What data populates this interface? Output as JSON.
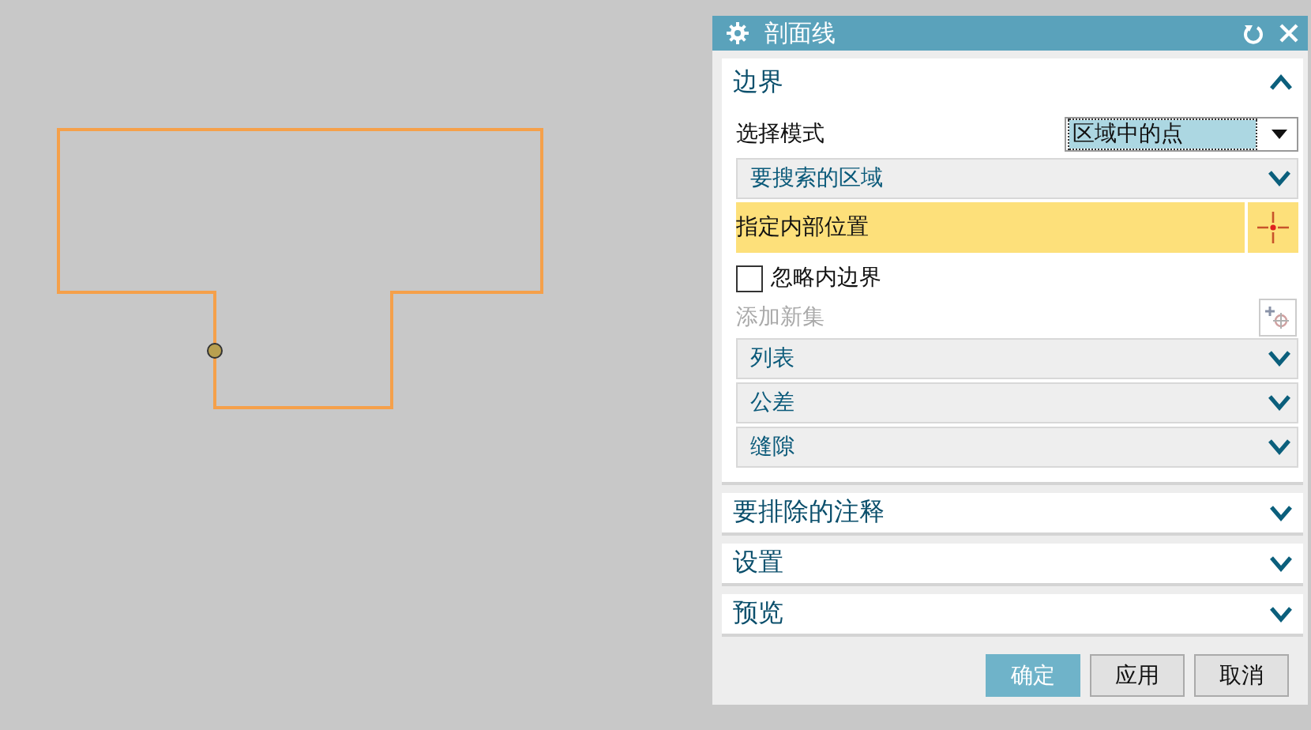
{
  "window": {
    "title": "剖面线"
  },
  "sections": [
    {
      "title": "边界",
      "expanded": true,
      "rows": [
        {
          "kind": "select",
          "label": "选择模式",
          "value": "区域中的点"
        },
        {
          "kind": "group",
          "title": "要搜索的区域",
          "expanded": false
        },
        {
          "kind": "selection",
          "label": "指定内部位置",
          "selected": true
        },
        {
          "kind": "checkbox",
          "label": "忽略内边界",
          "checked": false
        },
        {
          "kind": "action",
          "label": "添加新集",
          "disabled": true
        },
        {
          "kind": "group",
          "title": "列表",
          "expanded": false
        },
        {
          "kind": "group",
          "title": "公差",
          "expanded": false
        },
        {
          "kind": "group",
          "title": "缝隙",
          "expanded": false
        }
      ]
    },
    {
      "title": "要排除的注释",
      "expanded": false
    },
    {
      "title": "设置",
      "expanded": false
    },
    {
      "title": "预览",
      "expanded": false
    }
  ],
  "buttons": [
    {
      "label": "确定",
      "primary": true
    },
    {
      "label": "应用",
      "primary": false
    },
    {
      "label": "取消",
      "primary": false
    }
  ]
}
